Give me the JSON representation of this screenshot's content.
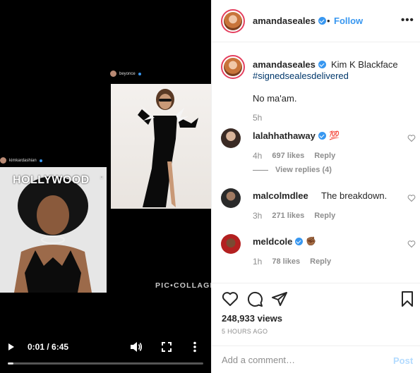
{
  "video": {
    "overlay_users": {
      "left": "kimkardashian",
      "right": "beyonce"
    },
    "hollywood_text": "HOLLYWOOD",
    "watermark": "PIC•COLLAGE",
    "time": "0:01 / 6:45",
    "progress_fraction": 0.004
  },
  "header": {
    "username": "amandaseales",
    "separator": "•",
    "follow_label": "Follow",
    "more_label": "•••"
  },
  "caption": {
    "username": "amandaseales",
    "text": "Kim K Blackface",
    "hashtag": "#signedsealesdelivered",
    "body": "No ma'am.",
    "time": "5h"
  },
  "comments": [
    {
      "username": "lalahhathaway",
      "text": "💯",
      "time": "4h",
      "likes": "697 likes",
      "reply": "Reply",
      "view_replies": "View replies (4)"
    },
    {
      "username": "malcolmdlee",
      "text": "The breakdown.",
      "time": "3h",
      "likes": "271 likes",
      "reply": "Reply"
    },
    {
      "username": "meldcole",
      "text": "✊🏾",
      "time": "1h",
      "likes": "78 likes",
      "reply": "Reply"
    }
  ],
  "stats": {
    "views": "248,933 views",
    "posted": "5 HOURS AGO"
  },
  "composer": {
    "placeholder": "Add a comment…",
    "post_label": "Post"
  },
  "colors": {
    "accent": "#3897f0",
    "story_ring": "#e4405f",
    "muted": "#8e8e8e",
    "post_disabled": "#b3dbff"
  }
}
